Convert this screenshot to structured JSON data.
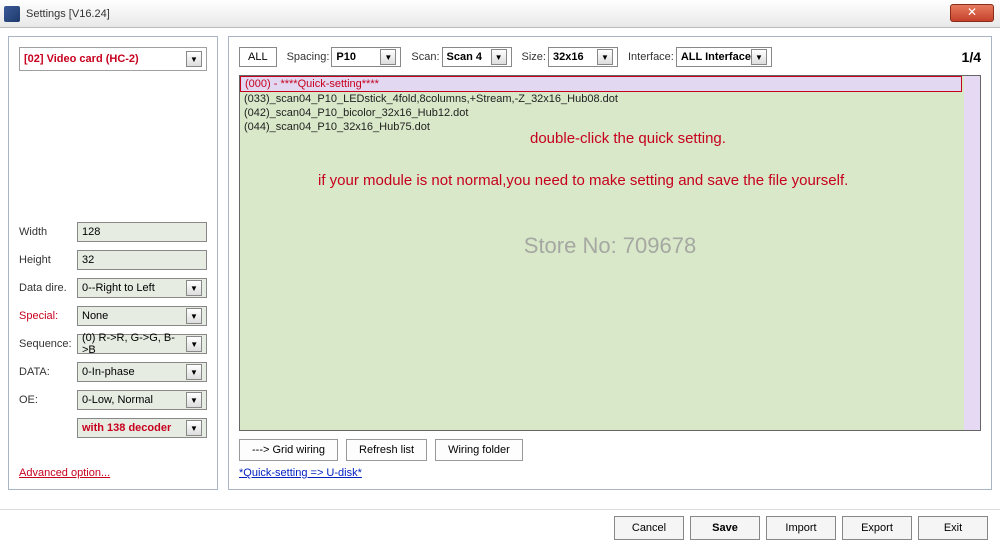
{
  "window": {
    "title": "Settings [V16.24]",
    "close": "✕"
  },
  "left": {
    "video_card": "[02] Video card (HC-2)",
    "fields": {
      "width": {
        "label": "Width",
        "value": "128"
      },
      "height": {
        "label": "Height",
        "value": "32"
      },
      "data_dire": {
        "label": "Data dire.",
        "value": "0--Right to Left"
      },
      "special": {
        "label": "Special:",
        "value": "None"
      },
      "sequence": {
        "label": "Sequence:",
        "value": "(0) R->R, G->G, B->B"
      },
      "data": {
        "label": "DATA:",
        "value": "0-In-phase"
      },
      "oe": {
        "label": "OE:",
        "value": "0-Low, Normal"
      },
      "decoder": {
        "label": "",
        "value": "with 138 decoder"
      }
    },
    "advanced": "Advanced option..."
  },
  "right": {
    "filters": {
      "all": "ALL",
      "spacing": {
        "label": "Spacing:",
        "value": "P10"
      },
      "scan": {
        "label": "Scan:",
        "value": "Scan 4"
      },
      "size": {
        "label": "Size:",
        "value": "32x16"
      },
      "interface": {
        "label": "Interface:",
        "value": "ALL Interface"
      }
    },
    "page": "1/4",
    "list": [
      "(000) - ****Quick-setting****",
      "(033)_scan04_P10_LEDstick_4fold,8columns,+Stream,-Z_32x16_Hub08.dot",
      "(042)_scan04_P10_bicolor_32x16_Hub12.dot",
      "(044)_scan04_P10_32x16_Hub75.dot"
    ],
    "annot1": "double-click the quick setting.",
    "annot2": "if your module is not normal,you need to make setting and save the file yourself.",
    "watermark": "Store No: 709678",
    "actions": {
      "grid": "---> Grid wiring",
      "refresh": "Refresh list",
      "folder": "Wiring folder"
    },
    "quicklink": "*Quick-setting => U-disk*"
  },
  "footer": {
    "cancel": "Cancel",
    "save": "Save",
    "import": "Import",
    "export": "Export",
    "exit": "Exit"
  }
}
